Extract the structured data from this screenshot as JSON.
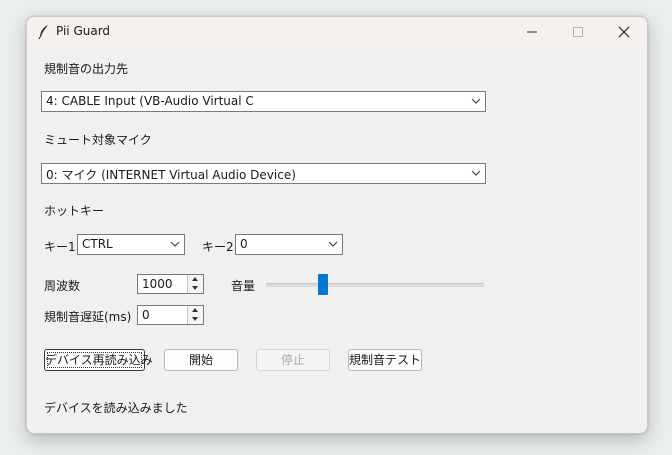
{
  "window": {
    "title": "Pii Guard"
  },
  "output_device": {
    "label": "規制音の出力先",
    "value": "4: CABLE Input (VB-Audio Virtual C"
  },
  "mute_mic": {
    "label": "ミュート対象マイク",
    "value": "0: マイク (INTERNET Virtual Audio Device)"
  },
  "hotkey": {
    "label": "ホットキー",
    "key1_label": "キー1",
    "key1_value": "CTRL",
    "key2_label": "キー2",
    "key2_value": "0"
  },
  "frequency": {
    "label": "周波数",
    "value": "1000"
  },
  "volume": {
    "label": "音量",
    "level": 0.25
  },
  "delay": {
    "label": "規制音遅延(ms)",
    "value": "0"
  },
  "buttons": {
    "reload": "デバイス再読み込み",
    "start": "開始",
    "stop": "停止",
    "test": "規制音テスト"
  },
  "status": "デバイスを読み込みました",
  "colors": {
    "accent": "#0078d4"
  }
}
